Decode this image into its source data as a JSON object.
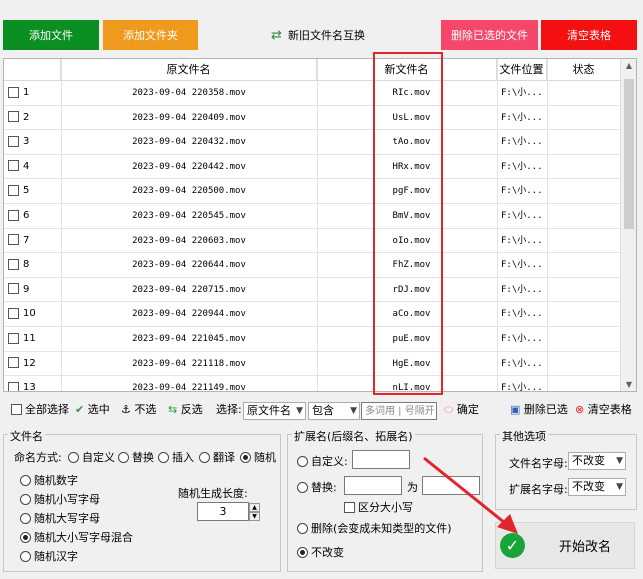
{
  "top_buttons": {
    "add_file": "添加文件",
    "add_folder": "添加文件夹",
    "swap": "新旧文件名互换",
    "delete_selected": "删除已选的文件",
    "clear_table": "清空表格"
  },
  "columns": [
    "原文件名",
    "新文件名",
    "文件位置",
    "状态"
  ],
  "rows": [
    {
      "idx": "1",
      "orig": "2023-09-04 220358.mov",
      "new": "RIc.mov",
      "pos": "F:\\小..."
    },
    {
      "idx": "2",
      "orig": "2023-09-04 220409.mov",
      "new": "UsL.mov",
      "pos": "F:\\小..."
    },
    {
      "idx": "3",
      "orig": "2023-09-04 220432.mov",
      "new": "tAo.mov",
      "pos": "F:\\小..."
    },
    {
      "idx": "4",
      "orig": "2023-09-04 220442.mov",
      "new": "HRx.mov",
      "pos": "F:\\小..."
    },
    {
      "idx": "5",
      "orig": "2023-09-04 220500.mov",
      "new": "pgF.mov",
      "pos": "F:\\小..."
    },
    {
      "idx": "6",
      "orig": "2023-09-04 220545.mov",
      "new": "BmV.mov",
      "pos": "F:\\小..."
    },
    {
      "idx": "7",
      "orig": "2023-09-04 220603.mov",
      "new": "oIo.mov",
      "pos": "F:\\小..."
    },
    {
      "idx": "8",
      "orig": "2023-09-04 220644.mov",
      "new": "FhZ.mov",
      "pos": "F:\\小..."
    },
    {
      "idx": "9",
      "orig": "2023-09-04 220715.mov",
      "new": "rDJ.mov",
      "pos": "F:\\小..."
    },
    {
      "idx": "10",
      "orig": "2023-09-04 220944.mov",
      "new": "aCo.mov",
      "pos": "F:\\小..."
    },
    {
      "idx": "11",
      "orig": "2023-09-04 221045.mov",
      "new": "puE.mov",
      "pos": "F:\\小..."
    },
    {
      "idx": "12",
      "orig": "2023-09-04 221118.mov",
      "new": "HgE.mov",
      "pos": "F:\\小..."
    },
    {
      "idx": "13",
      "orig": "2023-09-04 221149.mov",
      "new": "nLI.mov",
      "pos": "F:\\小..."
    }
  ],
  "toolbar": {
    "select_all": "全部选择",
    "select": "选中",
    "unselect": "不选",
    "invert": "反选",
    "choose_label": "选择:",
    "field_select": "原文件名",
    "match_select": "包含",
    "filter_placeholder": "多词用 | 号隔开",
    "confirm": "确定",
    "delete_selected": "删除已选",
    "clear_table": "清空表格"
  },
  "filename_group": {
    "title": "文件名",
    "mode_label": "命名方式:",
    "modes": [
      "自定义",
      "替换",
      "插入",
      "翻译",
      "随机"
    ],
    "mode_selected": "随机",
    "random_options": [
      "随机数字",
      "随机小写字母",
      "随机大写字母",
      "随机大小写字母混合",
      "随机汉字"
    ],
    "random_selected": "随机大小写字母混合",
    "length_label": "随机生成长度:",
    "length_value": "3"
  },
  "ext_group": {
    "title": "扩展名(后缀名、拓展名)",
    "custom": "自定义:",
    "replace": "替换:",
    "for": "为",
    "case_sensitive": "区分大小写",
    "delete": "删除(会变成未知类型的文件)",
    "no_change": "不改变",
    "selected": "不改变"
  },
  "other_group": {
    "title": "其他选项",
    "name_case_label": "文件名字母:",
    "name_case_value": "不改变",
    "ext_case_label": "扩展名字母:",
    "ext_case_value": "不改变"
  },
  "start_button": "开始改名",
  "colors": {
    "accent_red": "#e0262b",
    "green": "#0b8f22",
    "orange": "#f09a1d",
    "pink": "#f5476b",
    "red": "#f41010"
  }
}
